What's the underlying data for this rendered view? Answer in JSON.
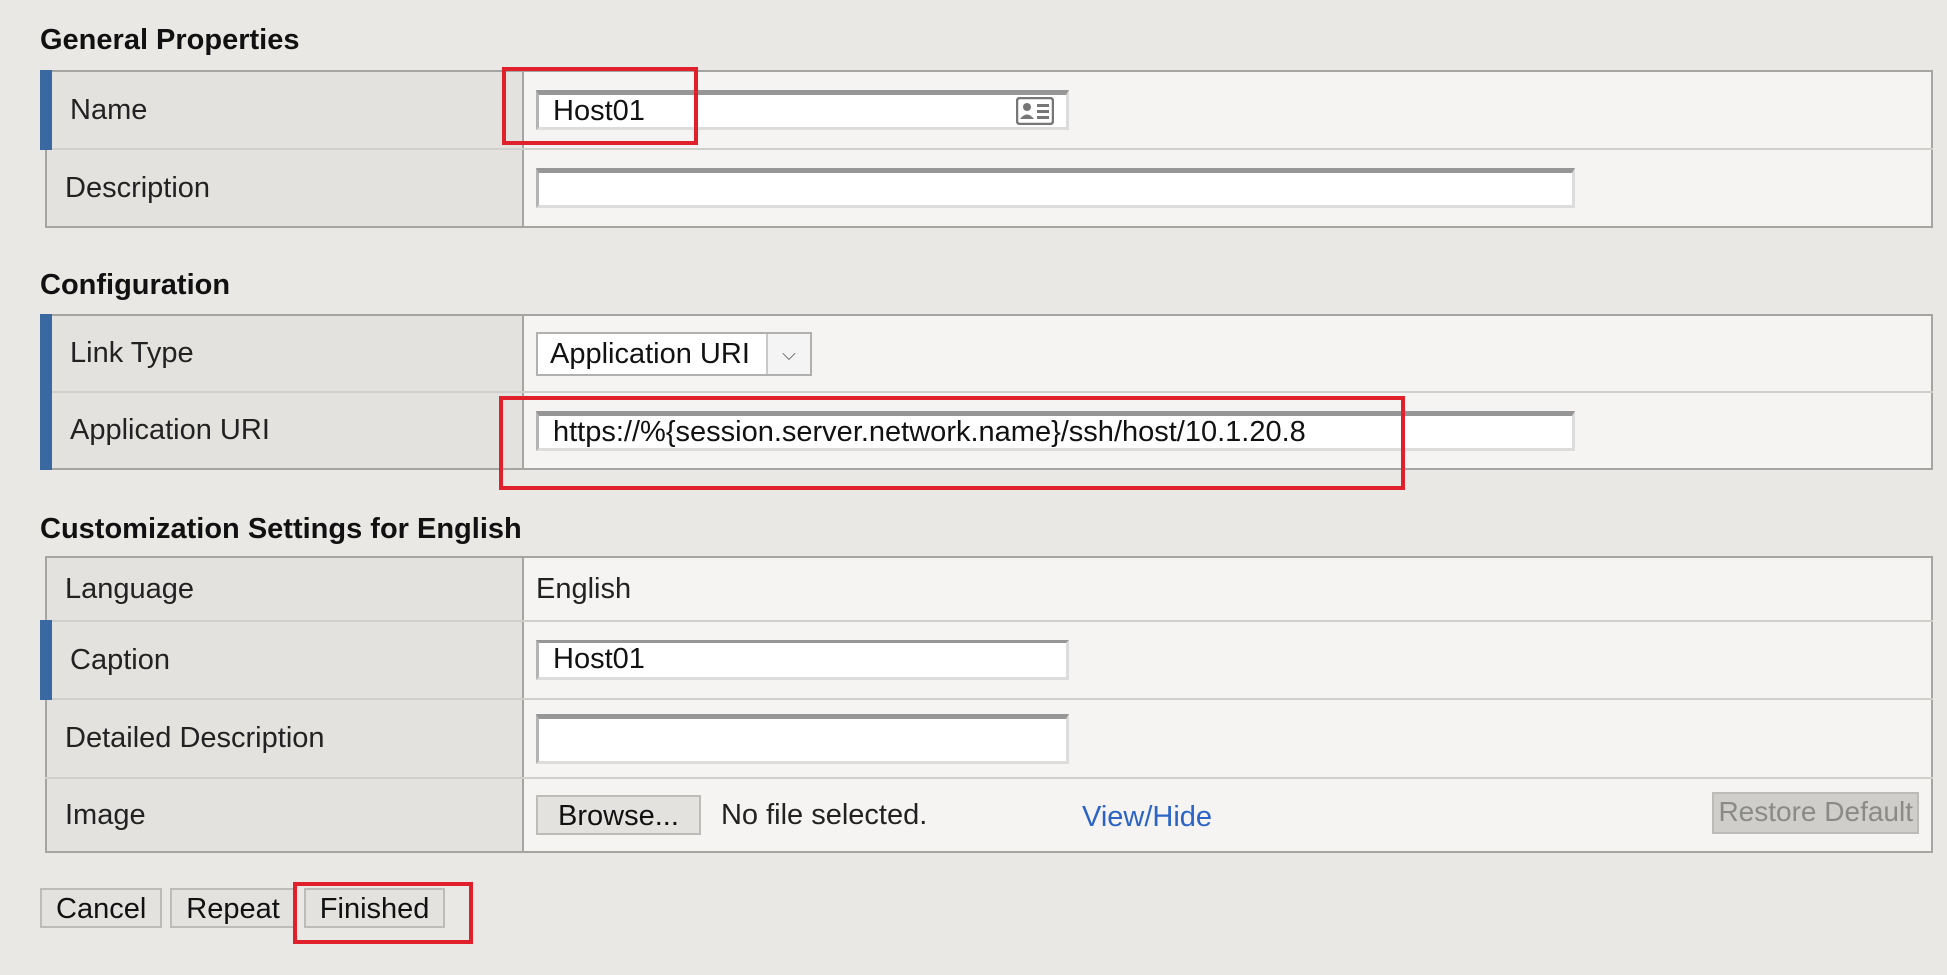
{
  "general": {
    "title": "General Properties",
    "name_label": "Name",
    "name_value": "Host01",
    "name_icon": "contact-card-icon",
    "description_label": "Description",
    "description_value": ""
  },
  "configuration": {
    "title": "Configuration",
    "link_type_label": "Link Type",
    "link_type_value": "Application URI",
    "app_uri_label": "Application URI",
    "app_uri_value": "https://%{session.server.network.name}/ssh/host/10.1.20.8"
  },
  "customization": {
    "title": "Customization Settings for English",
    "language_label": "Language",
    "language_value": "English",
    "caption_label": "Caption",
    "caption_value": "Host01",
    "detailed_description_label": "Detailed Description",
    "detailed_description_value": "",
    "image_label": "Image",
    "browse_label": "Browse...",
    "no_file_text": "No file selected.",
    "view_hide_label": "View/Hide",
    "restore_default_label": "Restore Default"
  },
  "actions": {
    "cancel_label": "Cancel",
    "repeat_label": "Repeat",
    "finished_label": "Finished"
  },
  "colors": {
    "required_marker": "#3a68a0",
    "highlight_box": "#e0202a",
    "link": "#2b63c6"
  }
}
